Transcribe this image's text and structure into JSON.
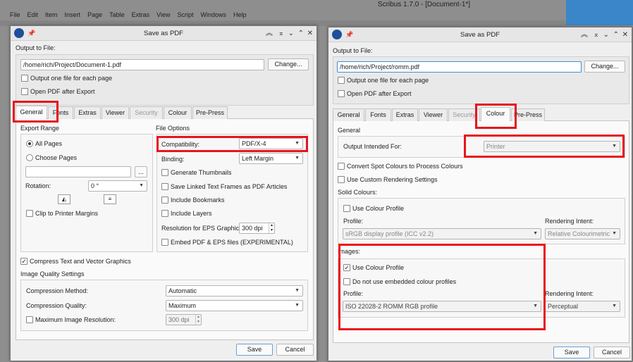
{
  "app": {
    "title": "Scribus 1.7.0 - [Document-1*]",
    "menu": [
      "File",
      "Edit",
      "Item",
      "Insert",
      "Page",
      "Table",
      "Extras",
      "View",
      "Script",
      "Windows",
      "Help"
    ]
  },
  "left": {
    "title": "Save as PDF",
    "output_label": "Output to File:",
    "path": "/home/rich/Project/Document-1.pdf",
    "change": "Change...",
    "one_file": "Output one file for each page",
    "open_after": "Open PDF after Export",
    "tabs": [
      "General",
      "Fonts",
      "Extras",
      "Viewer",
      "Security",
      "Colour",
      "Pre-Press"
    ],
    "active_tab": "General",
    "export_range": "Export Range",
    "all_pages": "All Pages",
    "choose_pages": "Choose Pages",
    "dots": "...",
    "rotation": "Rotation:",
    "rotation_val": "0 °",
    "clip": "Clip to Printer Margins",
    "file_options": "File Options",
    "compat": "Compatibility:",
    "compat_val": "PDF/X-4",
    "binding": "Binding:",
    "binding_val": "Left Margin",
    "thumbs": "Generate Thumbnails",
    "linked": "Save Linked Text Frames as PDF Articles",
    "bookmarks": "Include Bookmarks",
    "layers": "Include Layers",
    "eps_res": "Resolution for EPS Graphics:",
    "eps_val": "300 dpi",
    "embed": "Embed PDF & EPS files (EXPERIMENTAL)",
    "compress": "Compress Text and Vector Graphics",
    "img_quality": "Image Quality Settings",
    "comp_method": "Compression Method:",
    "comp_method_val": "Automatic",
    "comp_quality": "Compression Quality:",
    "comp_quality_val": "Maximum",
    "max_res": "Maximum Image Resolution:",
    "max_res_val": "300 dpi",
    "save": "Save",
    "cancel": "Cancel"
  },
  "right": {
    "title": "Save as PDF",
    "output_label": "Output to File:",
    "path": "/home/rich/Project/romm.pdf",
    "change": "Change...",
    "one_file": "Output one file for each page",
    "open_after": "Open PDF after Export",
    "tabs": [
      "General",
      "Fonts",
      "Extras",
      "Viewer",
      "Security",
      "Colour",
      "Pre-Press"
    ],
    "active_tab": "Colour",
    "general": "General",
    "intended": "Output Intended For:",
    "intended_val": "Printer",
    "convert_spot": "Convert Spot Colours to Process Colours",
    "custom_render": "Use Custom Rendering Settings",
    "solid": "Solid Colours:",
    "use_profile": "Use Colour Profile",
    "profile": "Profile:",
    "solid_profile_val": "sRGB display profile (ICC v2.2)",
    "intent": "Rendering Intent:",
    "solid_intent_val": "Relative Colourimetric",
    "images": "Images:",
    "img_use_profile": "Use Colour Profile",
    "no_embedded": "Do not use embedded colour profiles",
    "img_profile_val": "ISO 22028-2 ROMM RGB profile",
    "img_intent_val": "Perceptual",
    "save": "Save",
    "cancel": "Cancel"
  }
}
